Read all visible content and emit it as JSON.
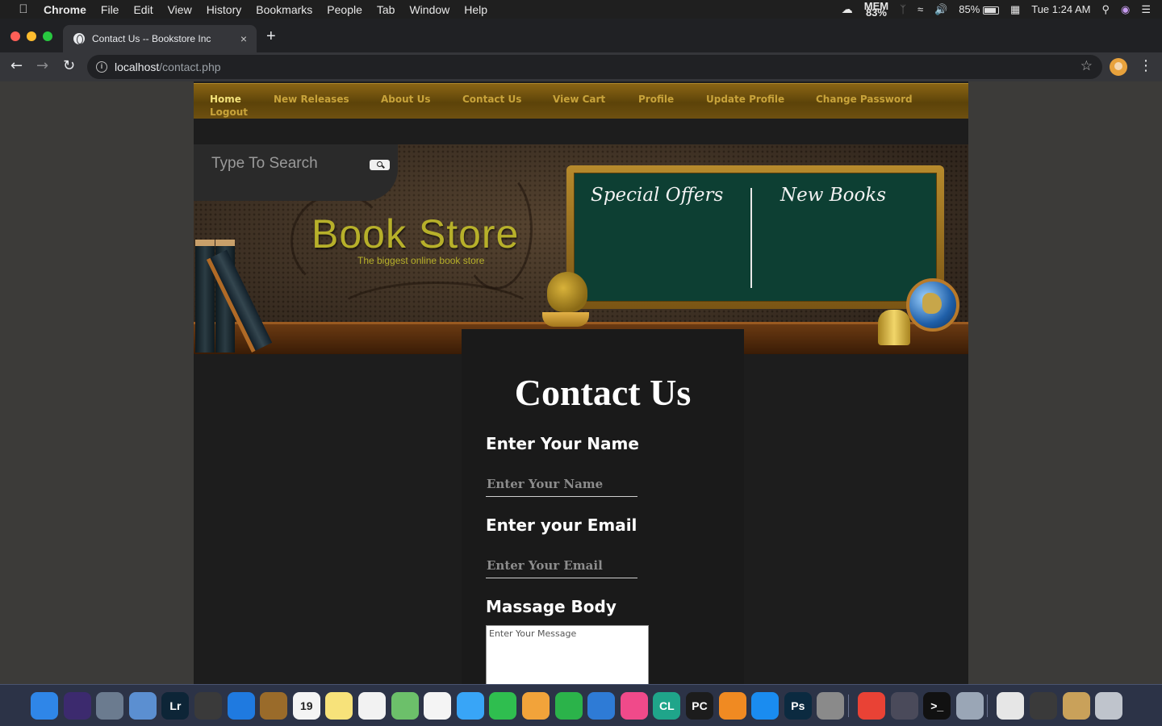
{
  "menubar": {
    "app_name": "Chrome",
    "items": [
      "File",
      "Edit",
      "View",
      "History",
      "Bookmarks",
      "People",
      "Tab",
      "Window",
      "Help"
    ],
    "mem_label": "MEM",
    "mem_value": "83%",
    "volume_glyph": "🔊",
    "battery": "85%",
    "battery_level": 0.85,
    "clock": "Tue 1:24 AM"
  },
  "browser": {
    "tab_title": "Contact Us -- Bookstore Inc",
    "tab_close": "×",
    "new_tab": "+",
    "url_host": "localhost",
    "url_path": "/contact.php",
    "info_glyph": "i",
    "star_glyph": "☆",
    "back_glyph": "←",
    "forward_glyph": "→",
    "reload_glyph": "↻",
    "menu_glyph": "⋮",
    "traffic_colors": [
      "#fe5f57",
      "#febc2e",
      "#28c840"
    ]
  },
  "site": {
    "nav": {
      "home": "Home",
      "new_releases": "New Releases",
      "about": "About Us",
      "contact": "Contact Us",
      "cart": "View Cart",
      "profile": "Profile",
      "update_profile": "Update Profile",
      "change_password": "Change Password",
      "logout": "Logout"
    },
    "search_placeholder": "Type To Search",
    "brand_title": "Book Store",
    "brand_tagline": "The biggest online book store",
    "board_left": "Special Offers",
    "board_right": "New Books",
    "colors": {
      "nav_link": "#c8a33a",
      "nav_active": "#f3e27a",
      "brand": "#b7b02a",
      "board": "#0d3f33"
    }
  },
  "contact": {
    "title": "Contact Us",
    "name_label": "Enter Your Name",
    "name_placeholder": "Enter Your Name",
    "email_label": "Enter your Email",
    "email_placeholder": "Enter Your Email",
    "message_label": "Massage Body",
    "message_placeholder": "Enter Your Message"
  },
  "dock": {
    "apps": [
      {
        "name": "finder",
        "color": "#2f86e8"
      },
      {
        "name": "siri",
        "color": "#3c2a6e"
      },
      {
        "name": "launchpad",
        "color": "#6b7b8f"
      },
      {
        "name": "preview",
        "color": "#5b8fd1"
      },
      {
        "name": "lightroom",
        "color": "#0d2537",
        "label": "Lr"
      },
      {
        "name": "final-cut",
        "color": "#3a3a3a"
      },
      {
        "name": "safari",
        "color": "#1f7ae0"
      },
      {
        "name": "notefile",
        "color": "#9a6b2a"
      },
      {
        "name": "calendar",
        "color": "#f4f4f4",
        "label": "19"
      },
      {
        "name": "notes",
        "color": "#f7e27a"
      },
      {
        "name": "reminders",
        "color": "#f2f2f2"
      },
      {
        "name": "maps",
        "color": "#6cc06a"
      },
      {
        "name": "photos",
        "color": "#f4f4f4"
      },
      {
        "name": "messages",
        "color": "#38a5f7"
      },
      {
        "name": "facetime",
        "color": "#2fbe4f"
      },
      {
        "name": "pages",
        "color": "#f2a33a"
      },
      {
        "name": "numbers",
        "color": "#2bb34a"
      },
      {
        "name": "keynote",
        "color": "#2e7bd6"
      },
      {
        "name": "itunes",
        "color": "#f04a8a"
      },
      {
        "name": "clion",
        "color": "#1fa58a",
        "label": "CL"
      },
      {
        "name": "pycharm",
        "color": "#1c1c1c",
        "label": "PC"
      },
      {
        "name": "books",
        "color": "#f08a22"
      },
      {
        "name": "app-store",
        "color": "#1a8cf0"
      },
      {
        "name": "photoshop",
        "color": "#0b2a40",
        "label": "Ps"
      },
      {
        "name": "system-preferences",
        "color": "#8a8a8a"
      },
      {
        "name": "chrome",
        "color": "#e94235"
      },
      {
        "name": "xcode-instruments",
        "color": "#4a4a5a"
      },
      {
        "name": "terminal",
        "color": "#111111",
        "label": ">_"
      },
      {
        "name": "settings-gear",
        "color": "#9aa6b6"
      },
      {
        "name": "document-stack",
        "color": "#e6e6e6"
      },
      {
        "name": "image-capture",
        "color": "#3a3a3a"
      },
      {
        "name": "folder-stack",
        "color": "#c9a15a"
      },
      {
        "name": "trash",
        "color": "#bfc4cc"
      }
    ]
  }
}
